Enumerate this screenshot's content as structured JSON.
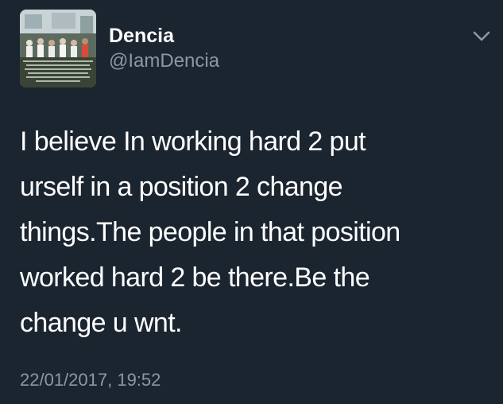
{
  "tweet": {
    "author": {
      "display_name": "Dencia",
      "handle": "@IamDencia",
      "avatar_icon": "profile-photo"
    },
    "text": "I believe In working hard 2 put\nurself in a position 2 change\nthings.The people in that position\nworked hard 2 be there.Be the\nchange u wnt.",
    "timestamp": "22/01/2017, 19:52",
    "menu_icon": "chevron-down-icon"
  },
  "colors": {
    "background": "#1b2530",
    "primary_text": "#ffffff",
    "secondary_text": "#8899a6"
  }
}
